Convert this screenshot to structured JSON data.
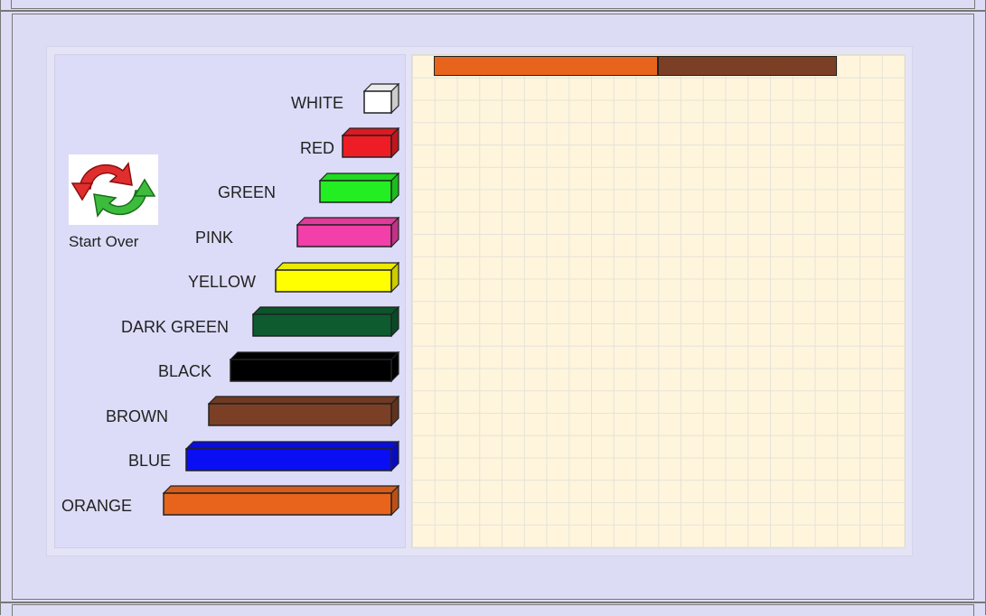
{
  "start_over": {
    "label": "Start Over",
    "icon": "refresh-arrows-icon"
  },
  "rods": [
    {
      "label": "WHITE",
      "color": "#ffffff",
      "units": 1
    },
    {
      "label": "RED",
      "color": "#ee1c24",
      "units": 2
    },
    {
      "label": "GREEN",
      "color": "#22ee22",
      "units": 3
    },
    {
      "label": "PINK",
      "color": "#f33fa9",
      "units": 4
    },
    {
      "label": "YELLOW",
      "color": "#ffff00",
      "units": 5
    },
    {
      "label": "DARK GREEN",
      "color": "#0d5b2f",
      "units": 6
    },
    {
      "label": "BLACK",
      "color": "#000000",
      "units": 7
    },
    {
      "label": "BROWN",
      "color": "#7b3f26",
      "units": 8
    },
    {
      "label": "BLUE",
      "color": "#0a0ef2",
      "units": 9
    },
    {
      "label": "ORANGE",
      "color": "#e8641c",
      "units": 10
    }
  ],
  "workspace": {
    "placed_rods": [
      {
        "name": "orange",
        "color": "#e8641c",
        "units": 10
      },
      {
        "name": "brown",
        "color": "#7b3f26",
        "units": 8
      }
    ]
  }
}
